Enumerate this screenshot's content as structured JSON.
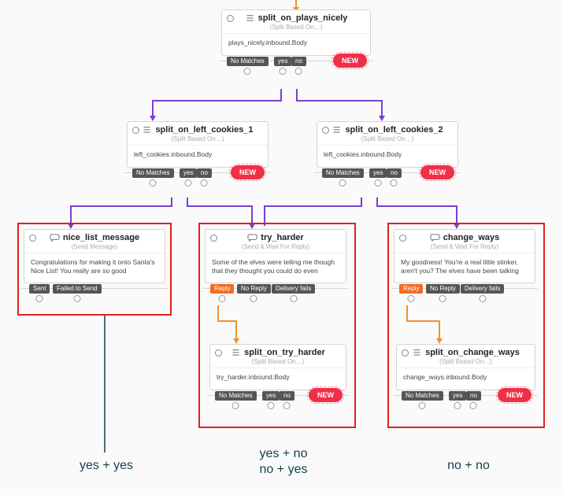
{
  "nodes": {
    "root": {
      "title": "split_on_plays_nicely",
      "subtype": "(Split Based On…)",
      "body": "plays_nicely.inbound.Body",
      "pills": [
        "No Matches",
        "yes",
        "no"
      ],
      "new": "NEW"
    },
    "left1": {
      "title": "split_on_left_cookies_1",
      "subtype": "(Split Based On…)",
      "body": "left_cookies.inbound.Body",
      "pills": [
        "No Matches",
        "yes",
        "no"
      ],
      "new": "NEW"
    },
    "left2": {
      "title": "split_on_left_cookies_2",
      "subtype": "(Split Based On…)",
      "body": "left_cookies.inbound.Body",
      "pills": [
        "No Matches",
        "yes",
        "no"
      ],
      "new": "NEW"
    },
    "nice": {
      "title": "nice_list_message",
      "subtype": "(Send Message)",
      "body": "Congratulations for making it onto Santa's Nice List! You really are so good",
      "pills": [
        "Sent",
        "Failed to Send"
      ]
    },
    "try": {
      "title": "try_harder",
      "subtype": "(Send & Wait For Reply)",
      "body": "Some of the elves were telling me though that they thought you could do even",
      "pills": [
        "Reply",
        "No Reply",
        "Delivery fails"
      ]
    },
    "trySplit": {
      "title": "split_on_try_harder",
      "subtype": "(Split Based On…)",
      "body": "try_harder.inbound.Body",
      "pills": [
        "No Matches",
        "yes",
        "no"
      ],
      "new": "NEW"
    },
    "change": {
      "title": "change_ways",
      "subtype": "(Send & Wait For Reply)",
      "body": "My goodness! You're a real little stinker, aren't you? The elves have been talking",
      "pills": [
        "Reply",
        "No Reply",
        "Delivery fails"
      ]
    },
    "changeSplit": {
      "title": "split_on_change_ways",
      "subtype": "(Split Based On…)",
      "body": "change_ways.inbound.Body",
      "pills": [
        "No Matches",
        "yes",
        "no"
      ],
      "new": "NEW"
    }
  },
  "captions": {
    "a": "yes + yes",
    "b": "yes + no\nno + yes",
    "c": "no + no"
  }
}
